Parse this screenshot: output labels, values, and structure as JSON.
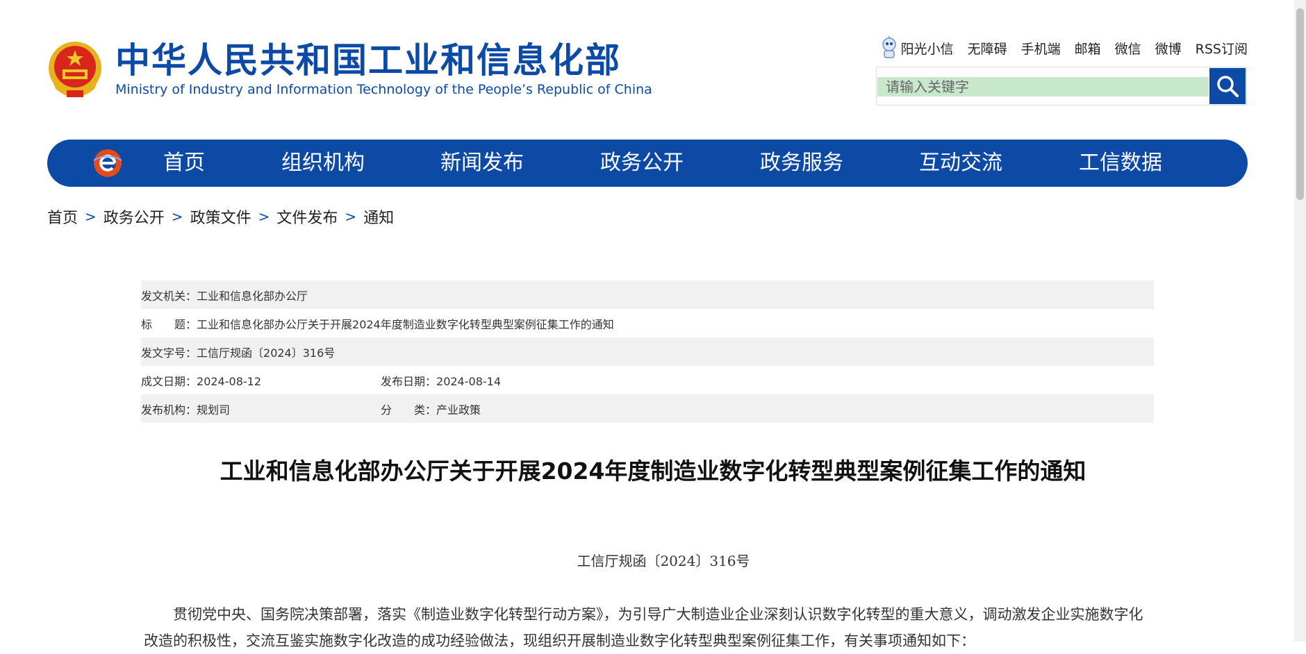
{
  "header": {
    "site_title_cn": "中华人民共和国工业和信息化部",
    "site_title_en": "Ministry of Industry and Information Technology of the People’s Republic of China",
    "top_links": [
      "阳光小信",
      "无障碍",
      "手机端",
      "邮箱",
      "微信",
      "微博",
      "RSS订阅"
    ],
    "search": {
      "placeholder": "请输入关键字",
      "icon": "search-icon"
    }
  },
  "nav": {
    "items": [
      "首页",
      "组织机构",
      "新闻发布",
      "政务公开",
      "政务服务",
      "互动交流",
      "工信数据"
    ]
  },
  "breadcrumb": [
    "首页",
    "政务公开",
    "政策文件",
    "文件发布",
    "通知"
  ],
  "meta": {
    "issuer_label": "发文机关：",
    "issuer": "工业和信息化部办公厅",
    "title_label": "标　　题：",
    "title": "工业和信息化部办公厅关于开展2024年度制造业数字化转型典型案例征集工作的通知",
    "doc_no_label": "发文字号：",
    "doc_no": "工信厅规函〔2024〕316号",
    "created_label": "成文日期：",
    "created": "2024-08-12",
    "published_label": "发布日期：",
    "published": "2024-08-14",
    "agency_label": "发布机构：",
    "agency": "规划司",
    "category_label": "分　　类：",
    "category": "产业政策"
  },
  "article": {
    "title": "工业和信息化部办公厅关于开展2024年度制造业数字化转型典型案例征集工作的通知",
    "doc_number": "工信厅规函〔2024〕316号",
    "paragraph": "贯彻党中央、国务院决策部署，落实《制造业数字化转型行动方案》，为引导广大制造业企业深刻认识数字化转型的重大意义，调动激发企业实施数字化改造的积极性，交流互鉴实施数字化改造的成功经验做法，现组织开展制造业数字化转型典型案例征集工作，有关事项通知如下："
  },
  "colors": {
    "brand_blue": "#0c4aa6",
    "search_bg": "#c8e8cc",
    "row_alt": "#f1f1f1"
  }
}
